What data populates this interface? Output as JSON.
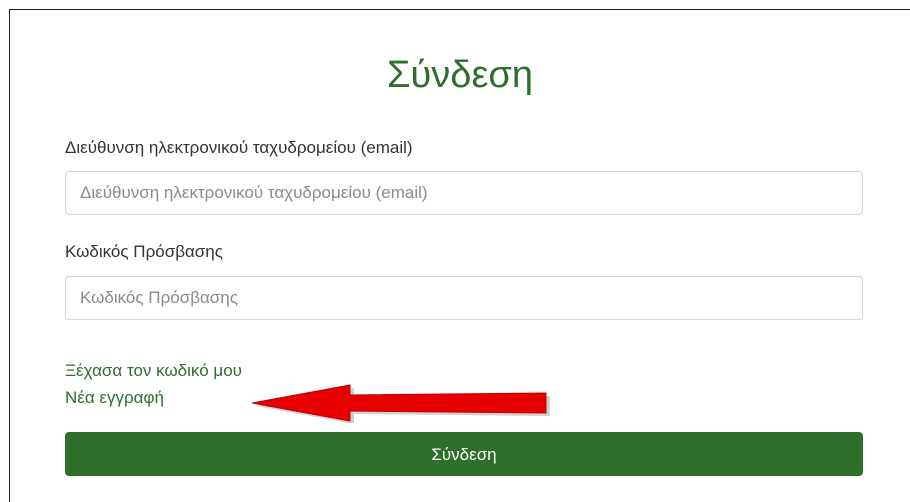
{
  "login": {
    "title": "Σύνδεση",
    "email_label": "Διεύθυνση ηλεκτρονικού ταχυδρομείου (email)",
    "email_placeholder": "Διεύθυνση ηλεκτρονικού ταχυδρομείου (email)",
    "email_value": "",
    "password_label": "Κωδικός Πρόσβασης",
    "password_placeholder": "Κωδικός Πρόσβασης",
    "password_value": "",
    "forgot_link": "Ξέχασα τον κωδικό μου",
    "register_link": "Νέα εγγραφή",
    "submit_label": "Σύνδεση"
  },
  "colors": {
    "accent": "#2e6f2c",
    "annotation_arrow": "#e60000"
  },
  "annotation": {
    "icon": "arrow-left-icon"
  }
}
